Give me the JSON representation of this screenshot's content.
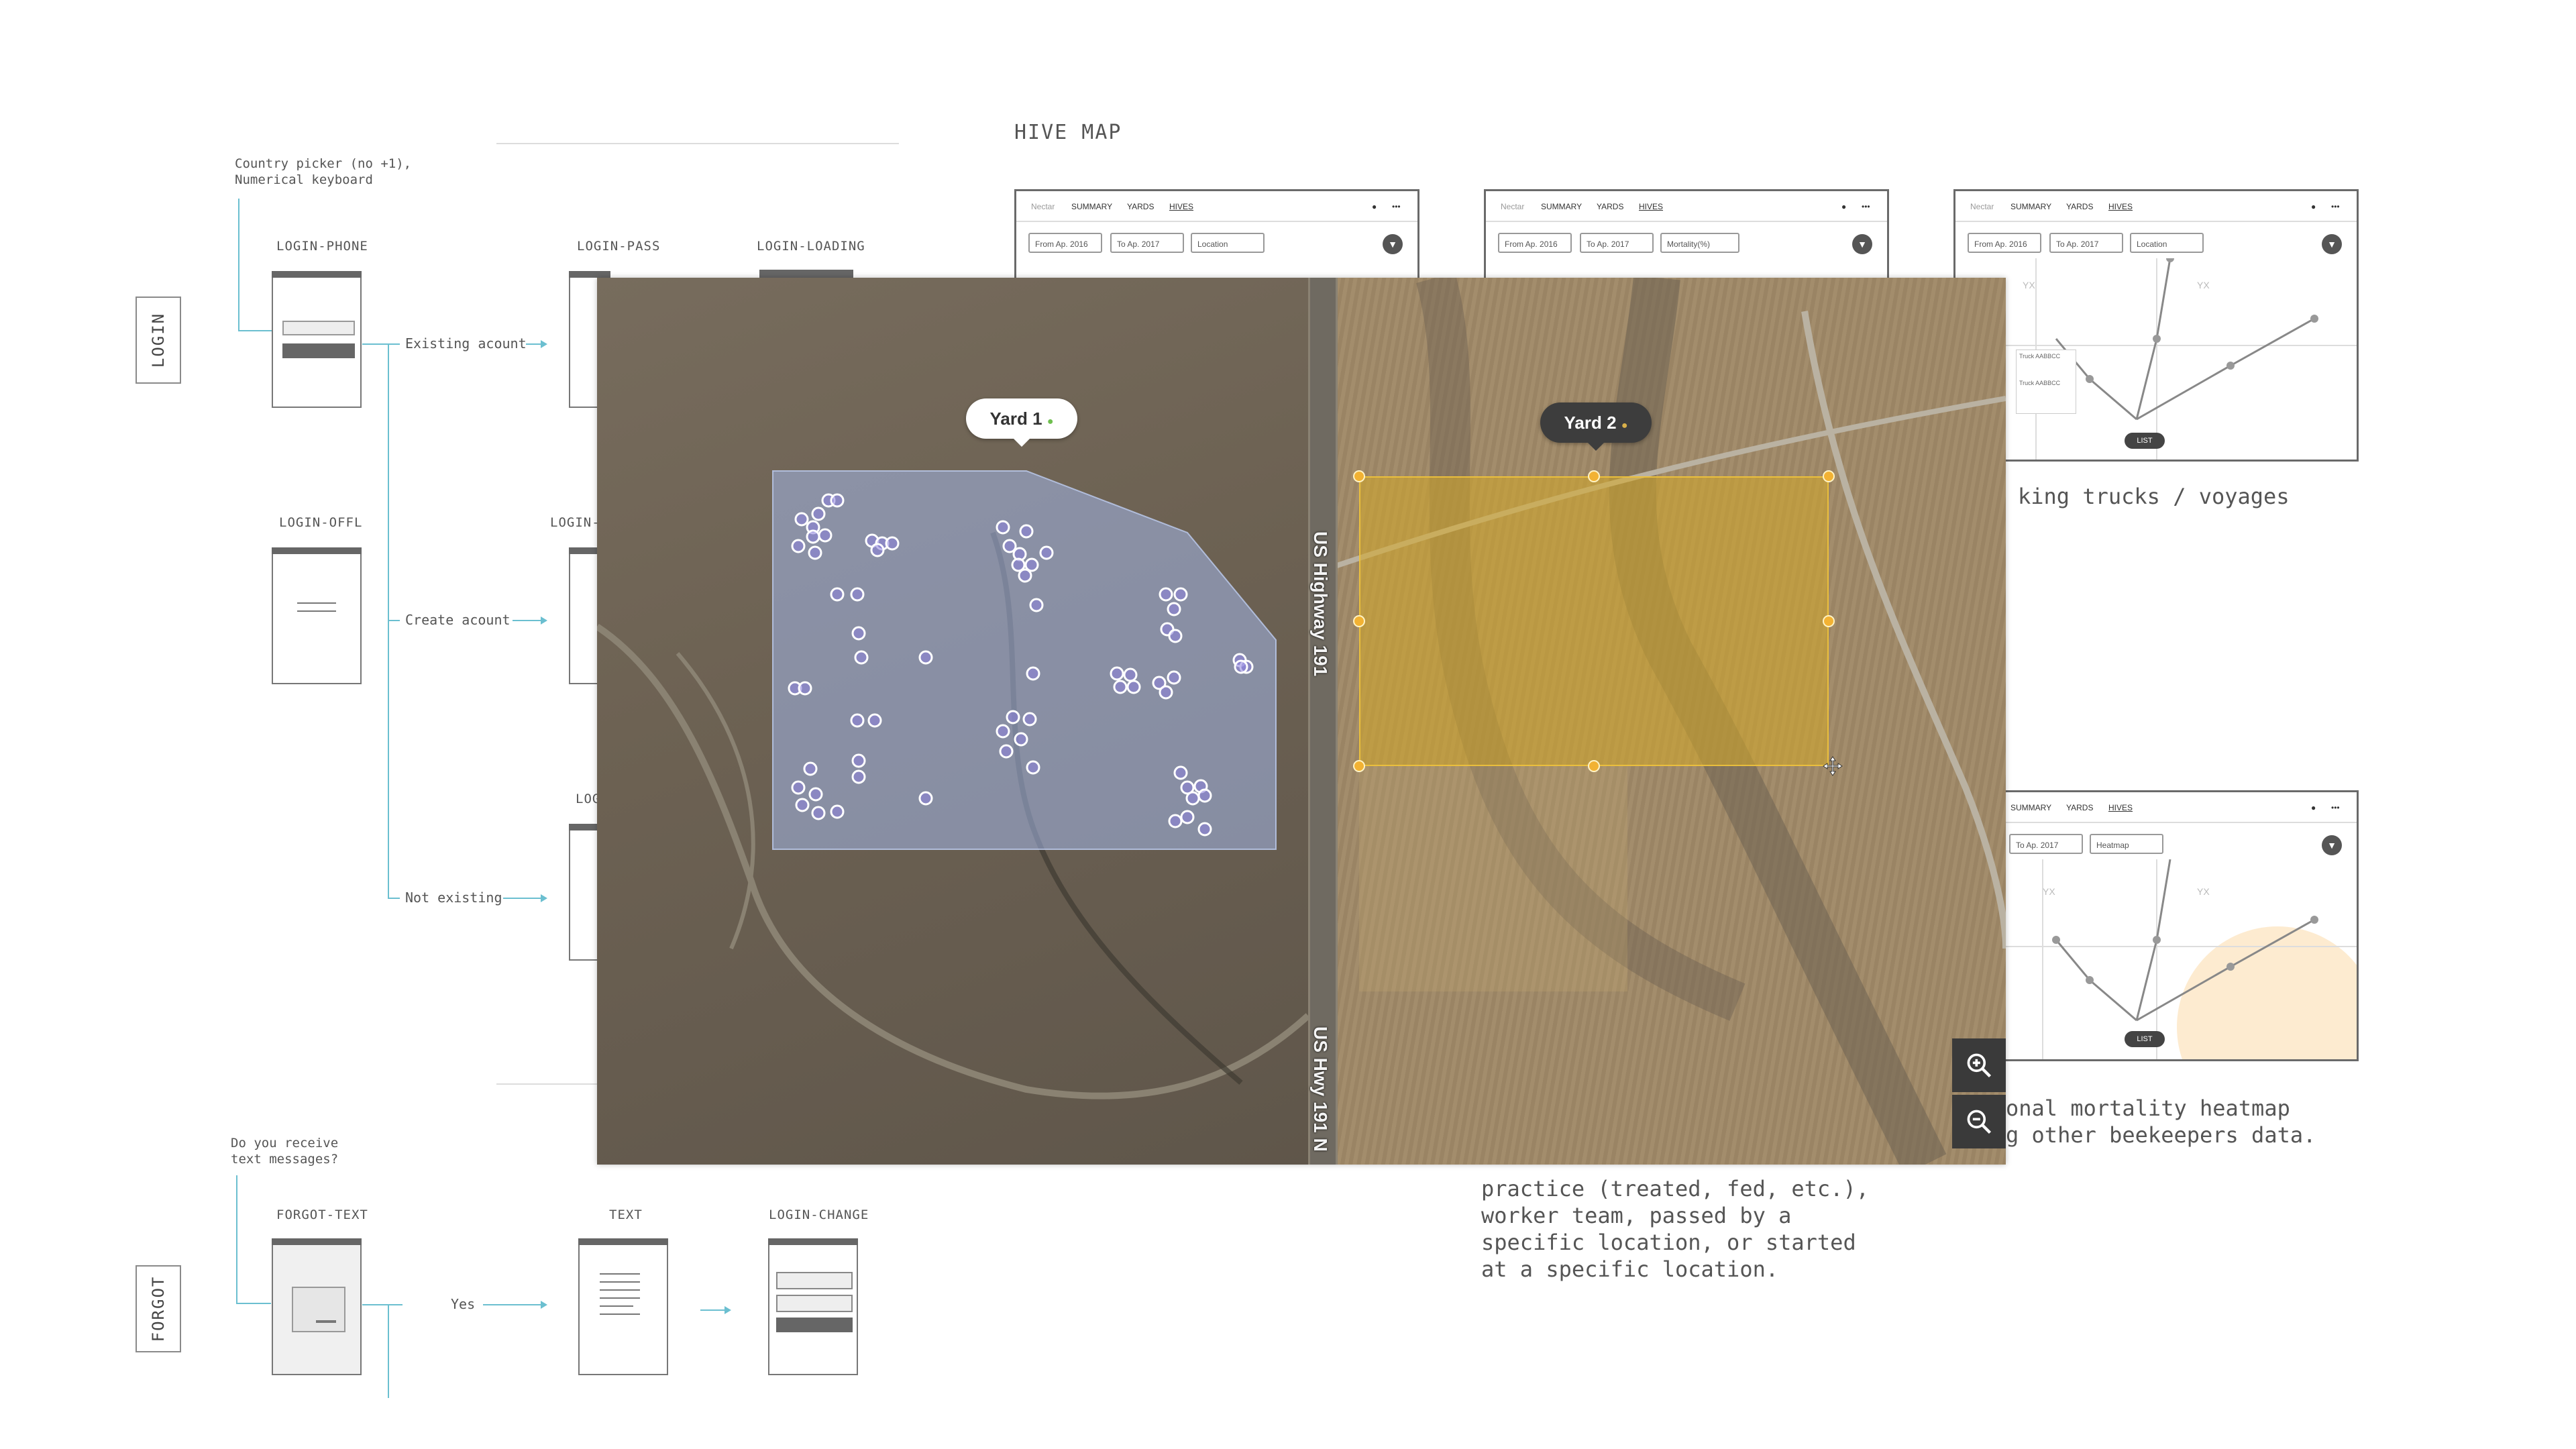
{
  "login": {
    "section_label": "LOGIN",
    "phone_note": [
      "Country picker (no +1),",
      "Numerical keyboard"
    ],
    "screens": {
      "phone": "LOGIN-PHONE",
      "pass": "LOGIN-PASS",
      "loading": "LOGIN-LOADING",
      "offline": "LOGIN-OFFL",
      "second": "LOGIN-L",
      "third": "LOG"
    },
    "branches": [
      "Existing acount",
      "Create acount",
      "Not existing"
    ]
  },
  "forgot": {
    "section_label": "FORGOT",
    "note": [
      "Do you receive",
      "text messages?"
    ],
    "screens": {
      "text_form": "FORGOT-TEXT",
      "text": "TEXT",
      "change": "LOGIN-CHANGE"
    },
    "branch_yes": "Yes"
  },
  "hive_map": {
    "title": "HIVE MAP",
    "mockup": {
      "nav": [
        "Nectar",
        "SUMMARY",
        "YARDS",
        "HIVES"
      ],
      "from": "From Ap. 2016",
      "to": "To Ap. 2017",
      "selects": [
        "Location",
        "Mortality(%)",
        "Location",
        "Heatmap"
      ],
      "list_button": "LIST",
      "yx": "YX",
      "truck_cards": [
        "Truck AABBCC",
        "Truck AABBCC"
      ]
    },
    "desc_tracking": "king trucks / voyages",
    "desc_heatmap": [
      "onal mortality heatmap",
      "g other beekeepers data."
    ],
    "desc_filter": [
      "practice (treated, fed, etc.),",
      "worker team, passed by a",
      "specific location, or started",
      "at a specific location."
    ]
  },
  "map_modal": {
    "road_labels": [
      "US Highway 191",
      "US Hwy 191 N"
    ],
    "yard1": "Yard 1",
    "yard2": "Yard 2",
    "colors": {
      "hive_fill": "#6a5acd",
      "yard1_area": "#a3b7e8",
      "yard2_area": "#d6aa28",
      "handle": "#f2b233"
    },
    "hive_count": 74,
    "icons": {
      "zoom_in": "zoom-in-icon",
      "zoom_out": "zoom-out-icon",
      "move": "move-cursor-icon"
    }
  }
}
